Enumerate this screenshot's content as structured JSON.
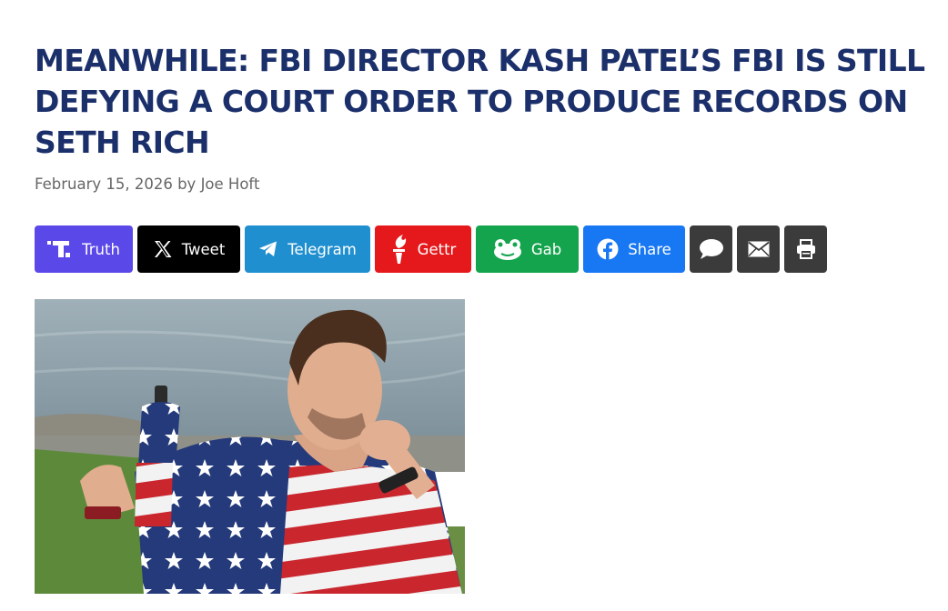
{
  "article": {
    "headline_lines": [
      "MEANWHILE: FBI DIRECTOR KASH PATEL’S FBI IS STILL",
      "DEFYING A COURT ORDER TO PRODUCE RECORDS ON",
      "SETH RICH"
    ],
    "byline": "February 15, 2026 by Joe Hoft"
  },
  "share_buttons": [
    {
      "label": "Truth",
      "icon": "truth-social-icon",
      "color": "#5b48e8"
    },
    {
      "label": "Tweet",
      "icon": "x-icon",
      "color": "#000000"
    },
    {
      "label": "Telegram",
      "icon": "telegram-icon",
      "color": "#1f8fcf"
    },
    {
      "label": "Gettr",
      "icon": "gettr-icon",
      "color": "#e5181b"
    },
    {
      "label": "Gab",
      "icon": "gab-frog-icon",
      "color": "#14a44d"
    },
    {
      "label": "Share",
      "icon": "facebook-icon",
      "color": "#1877f2"
    },
    {
      "label": "",
      "icon": "comment-icon",
      "color": "#3b3b3b"
    },
    {
      "label": "",
      "icon": "email-icon",
      "color": "#3b3b3b"
    },
    {
      "label": "",
      "icon": "print-icon",
      "color": "#3b3b3b"
    }
  ],
  "hero_image": {
    "subject": "man in American flag shirt holding bottle by water"
  }
}
